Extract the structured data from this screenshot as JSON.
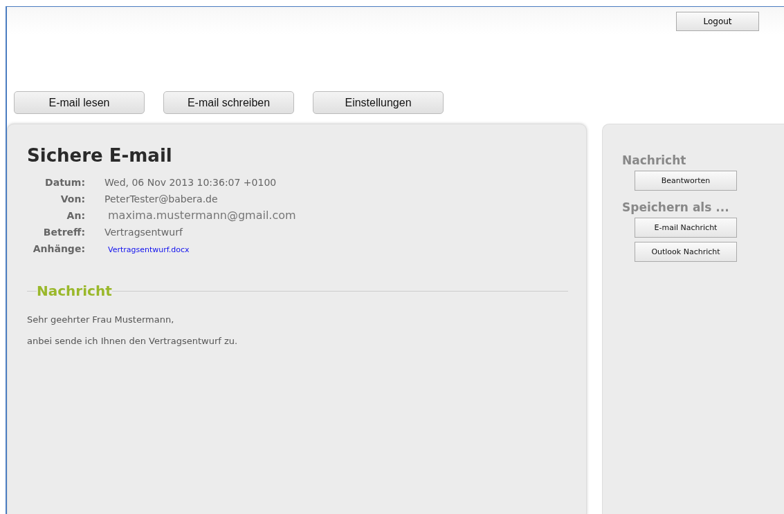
{
  "header": {
    "logout_button": "Logout"
  },
  "nav_buttons": [
    "E-mail lesen",
    "E-mail schreiben",
    "Einstellungen"
  ],
  "email": {
    "title": "Sichere E-mail",
    "fields": [
      {
        "label": "Datum:",
        "value": "Wed, 06 Nov 2013 10:36:07 +0100",
        "kind": "text"
      },
      {
        "label": "Von:",
        "value": "PeterTester@babera.de",
        "kind": "text"
      },
      {
        "label": "An:",
        "value": "maxima.mustermann@gmail.com",
        "kind": "large"
      },
      {
        "label": "Betreff:",
        "value": "Vertragsentwurf",
        "kind": "text"
      },
      {
        "label": "Anhänge:",
        "value": "Vertragsentwurf.docx",
        "kind": "link"
      }
    ],
    "message_heading": "Nachricht",
    "message_lines": [
      "Sehr geehrter Frau Mustermann,",
      "anbei sende ich Ihnen den Vertragsentwurf zu."
    ]
  },
  "sidebar": {
    "sections": [
      {
        "heading": "Nachricht",
        "buttons": [
          "Beantworten"
        ]
      },
      {
        "heading": "Speichern als ...",
        "buttons": [
          "E-mail Nachricht",
          "Outlook Nachricht"
        ]
      }
    ]
  }
}
